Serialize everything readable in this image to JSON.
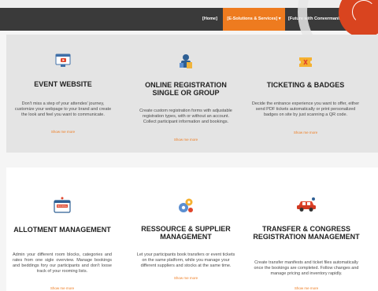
{
  "nav": {
    "home": "[Home]",
    "solutions": "[E-Solutions & Services] ▾",
    "future": "[Future with Convermania]"
  },
  "row1": [
    {
      "title": "EVENT WEBSITE",
      "desc": "Don't miss a step of your attendes' journey, customize your webpage to your brand and create the look and feel you want to communicate.",
      "more": "Show me more",
      "icon": "website-icon"
    },
    {
      "title": "ONLINE REGISTRATION SINGLE OR GROUP",
      "desc": "Create custom registration forms with adjustable registration types, with or without an account. Collect participant information and bookings.",
      "more": "Show me more",
      "icon": "registration-icon"
    },
    {
      "title": "TICKETING & BADGES",
      "desc": "Decide the entrance experience you want to offer, either send PDF tickets automatically or print personalized badges on site by just scanning a QR code.",
      "more": "Show me more",
      "icon": "ticket-icon"
    }
  ],
  "row2": [
    {
      "title": "ALLOTMENT MANAGEMENT",
      "desc": "Admin your different room blocks, categories and rates from one sigle overview. Manage bookings and beddings fory our participants and don't loose track of your rooming lists.",
      "more": "Show me more",
      "icon": "hotel-icon",
      "icon_label": "BOOKING"
    },
    {
      "title": "RESSOURCE & SUPPLIER MANAGEMENT",
      "desc": "Let your participants book transfers or event tickets on the same platform, while you manage your different suppliers and stocks at the same time.",
      "more": "Show me more",
      "icon": "supplier-icon"
    },
    {
      "title": "TRANSFER & CONGRESS REGISTRATION MANAGEMENT",
      "desc": "Create transfer manifests and ticket files automatically once the bookings are completed. Follow changes and manage pricing and inventory rapidly.",
      "more": "Show me more",
      "icon": "car-icon"
    }
  ]
}
